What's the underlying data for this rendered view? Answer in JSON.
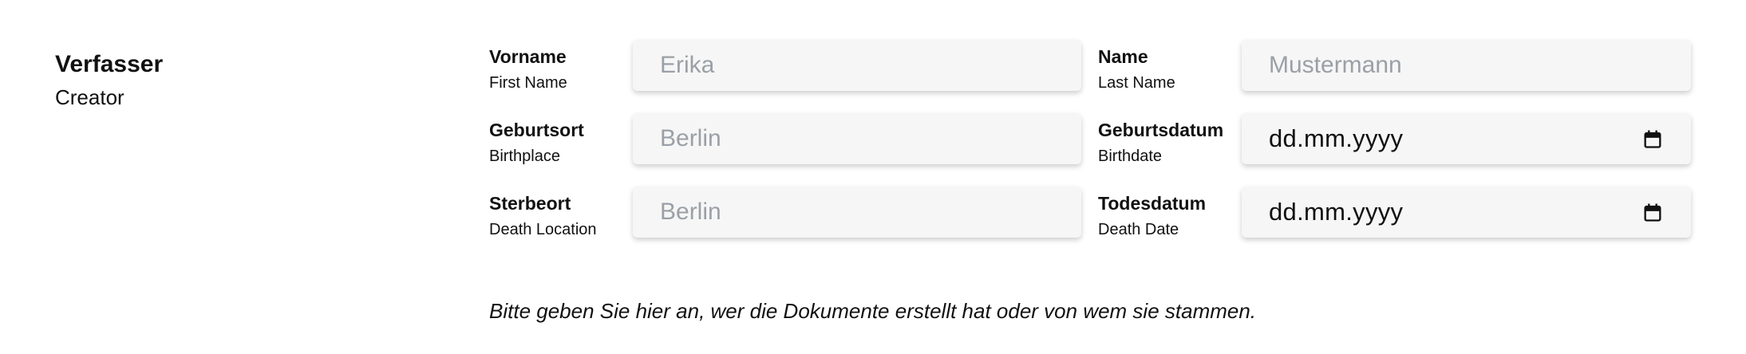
{
  "section": {
    "title": "Verfasser",
    "subtitle": "Creator"
  },
  "fields": {
    "first_name": {
      "label_de": "Vorname",
      "label_en": "First Name",
      "placeholder": "Erika",
      "value": ""
    },
    "last_name": {
      "label_de": "Name",
      "label_en": "Last Name",
      "placeholder": "Mustermann",
      "value": ""
    },
    "birthplace": {
      "label_de": "Geburtsort",
      "label_en": "Birthplace",
      "placeholder": "Berlin",
      "value": ""
    },
    "birthdate": {
      "label_de": "Geburtsdatum",
      "label_en": "Birthdate",
      "display": "dd.mm.yyyy",
      "icon": "calendar-icon"
    },
    "death_location": {
      "label_de": "Sterbeort",
      "label_en": "Death Location",
      "placeholder": "Berlin",
      "value": ""
    },
    "death_date": {
      "label_de": "Todesdatum",
      "label_en": "Death Date",
      "display": "dd.mm.yyyy",
      "icon": "calendar-icon"
    }
  },
  "help_text": "Bitte geben Sie hier an, wer die Dokumente erstellt hat oder von wem sie stammen.",
  "colors": {
    "input_background": "#f6f6f6",
    "placeholder": "#9aa0a6",
    "text": "#111111"
  }
}
